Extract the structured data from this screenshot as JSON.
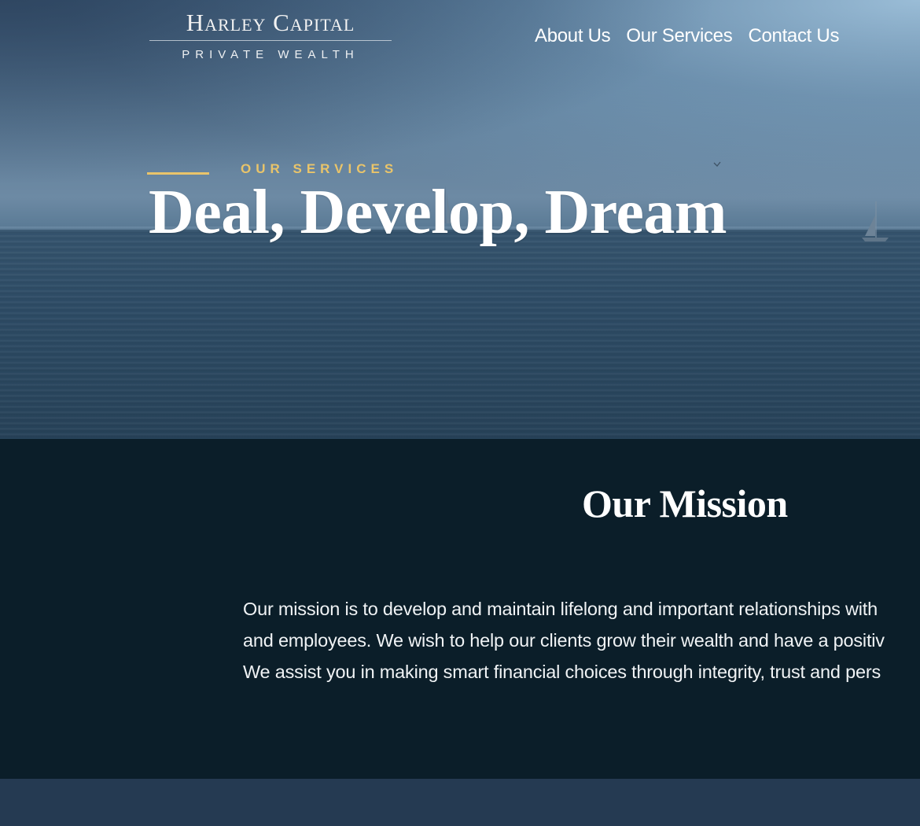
{
  "header": {
    "logo": {
      "title": "Harley Capital",
      "subtitle": "PRIVATE WEALTH"
    },
    "nav": [
      {
        "label": "About Us"
      },
      {
        "label": "Our Services"
      },
      {
        "label": "Contact Us"
      }
    ]
  },
  "hero": {
    "eyebrow": "OUR SERVICES",
    "title": "Deal, Develop, Dream",
    "accent_color": "#e9c46a"
  },
  "mission": {
    "title": "Our Mission",
    "lines": [
      "Our mission is to develop and maintain lifelong and important relationships with",
      "and employees. We wish to help our clients grow their wealth and have a positiv",
      "We assist you in making smart financial choices through integrity, trust and pers"
    ],
    "background_color": "#0b1e29"
  },
  "footer_band": {
    "background_color": "#253a52"
  }
}
